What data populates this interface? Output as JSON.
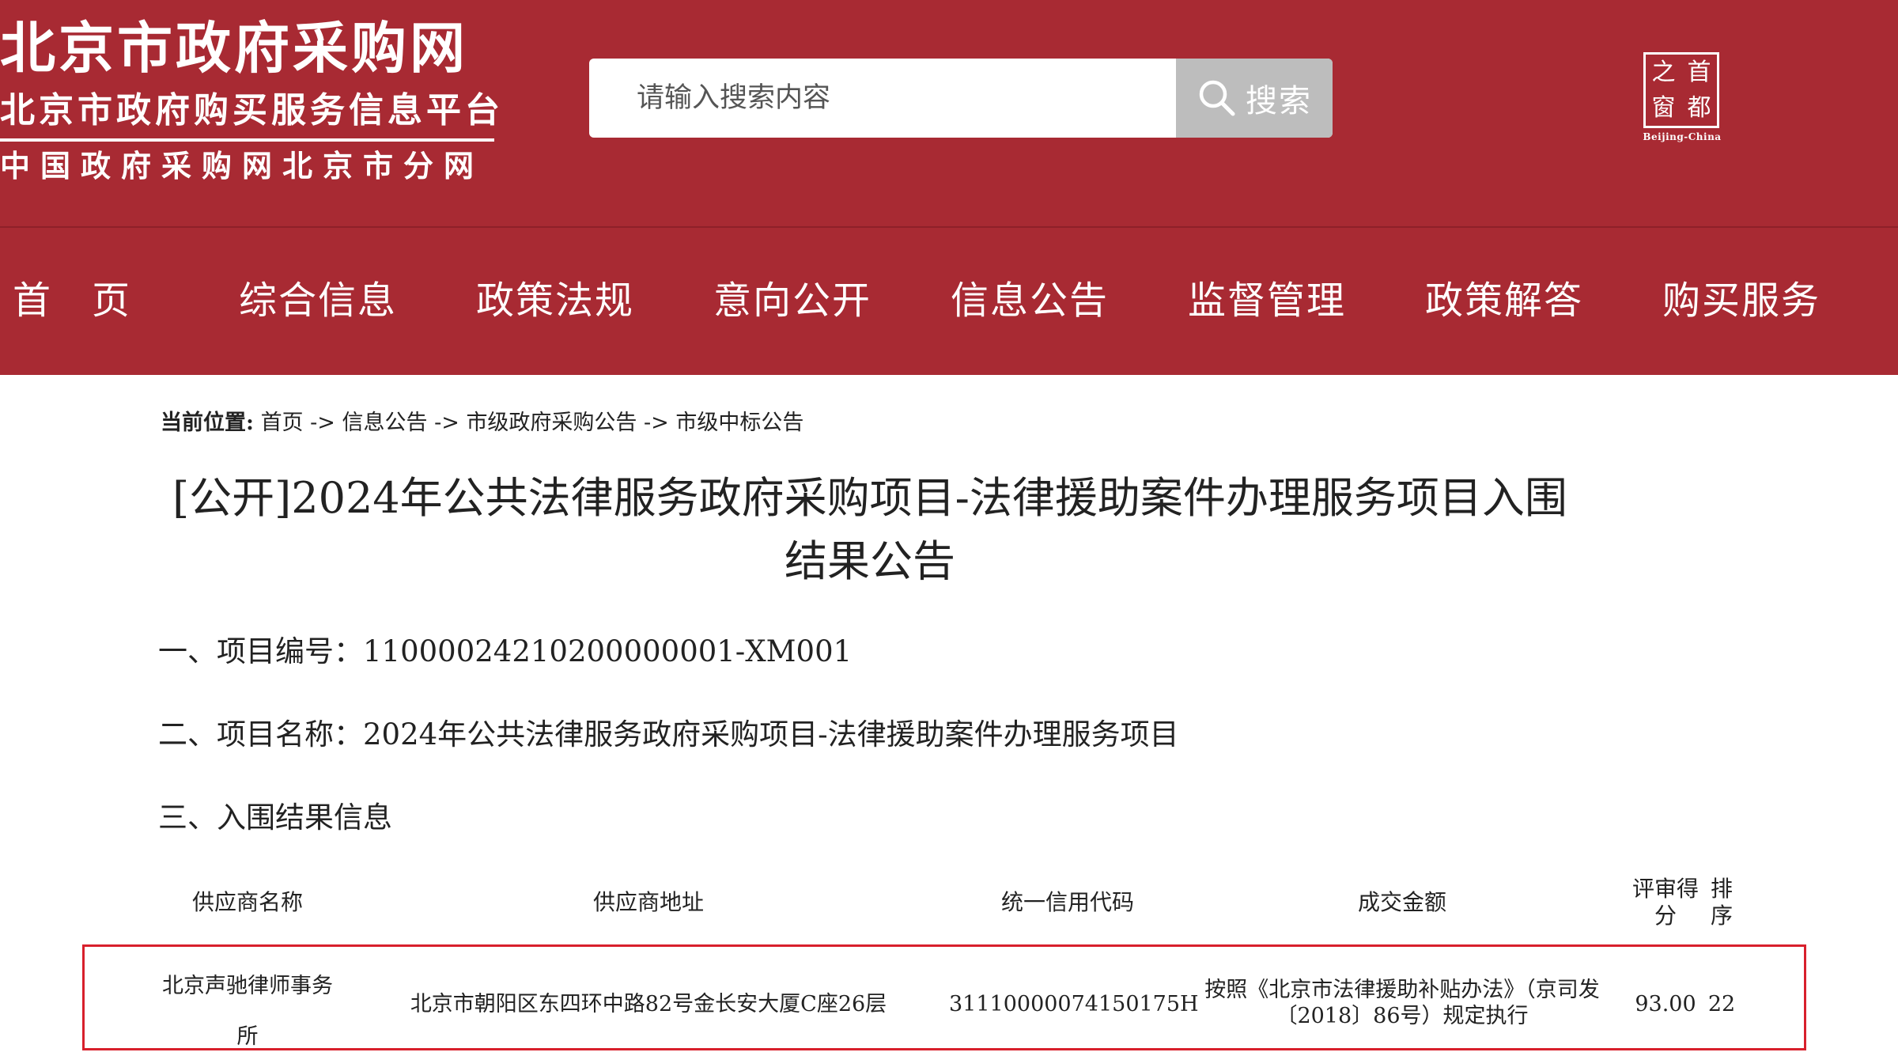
{
  "header": {
    "logo_main": "北京市政府采购网",
    "logo_sub": "北京市政府购买服务信息平台",
    "logo_sub2": "中国政府采购网北京市分网",
    "search_placeholder": "请输入搜索内容",
    "search_button": "搜索",
    "seal": {
      "chars": [
        "之",
        "首",
        "窗",
        "都"
      ],
      "caption": "Beijing-China"
    }
  },
  "nav": {
    "items": [
      {
        "label": "首　页"
      },
      {
        "label": "综合信息"
      },
      {
        "label": "政策法规"
      },
      {
        "label": "意向公开"
      },
      {
        "label": "信息公告"
      },
      {
        "label": "监督管理"
      },
      {
        "label": "政策解答"
      },
      {
        "label": "购买服务"
      }
    ]
  },
  "breadcrumb": {
    "label": "当前位置:",
    "items": [
      "首页",
      "信息公告",
      "市级政府采购公告",
      "市级中标公告"
    ],
    "separator": "->"
  },
  "article": {
    "title": "[公开]2024年公共法律服务政府采购项目-法律援助案件办理服务项目入围结果公告",
    "sections": [
      "一、项目编号：11000024210200000001-XM001",
      "二、项目名称：2024年公共法律服务政府采购项目-法律援助案件办理服务项目",
      "三、入围结果信息"
    ]
  },
  "table": {
    "headers": [
      "供应商名称",
      "供应商地址",
      "统一信用代码",
      "成交金额",
      "评审得分",
      "排序"
    ],
    "rows": [
      {
        "name": "北京声驰律师事务所",
        "address": "北京市朝阳区东四环中路82号金长安大厦C座26层",
        "credit_code": "31110000074150175H",
        "amount": "按照《北京市法律援助补贴办法》（京司发〔2018〕86号）规定执行",
        "score": "93.00",
        "rank": "22"
      }
    ]
  },
  "colors": {
    "brand_red": "#a82a33",
    "highlight_border": "#d8202c",
    "search_button_bg": "#bdbdbd"
  },
  "icons": {
    "search_button": "search-icon"
  }
}
